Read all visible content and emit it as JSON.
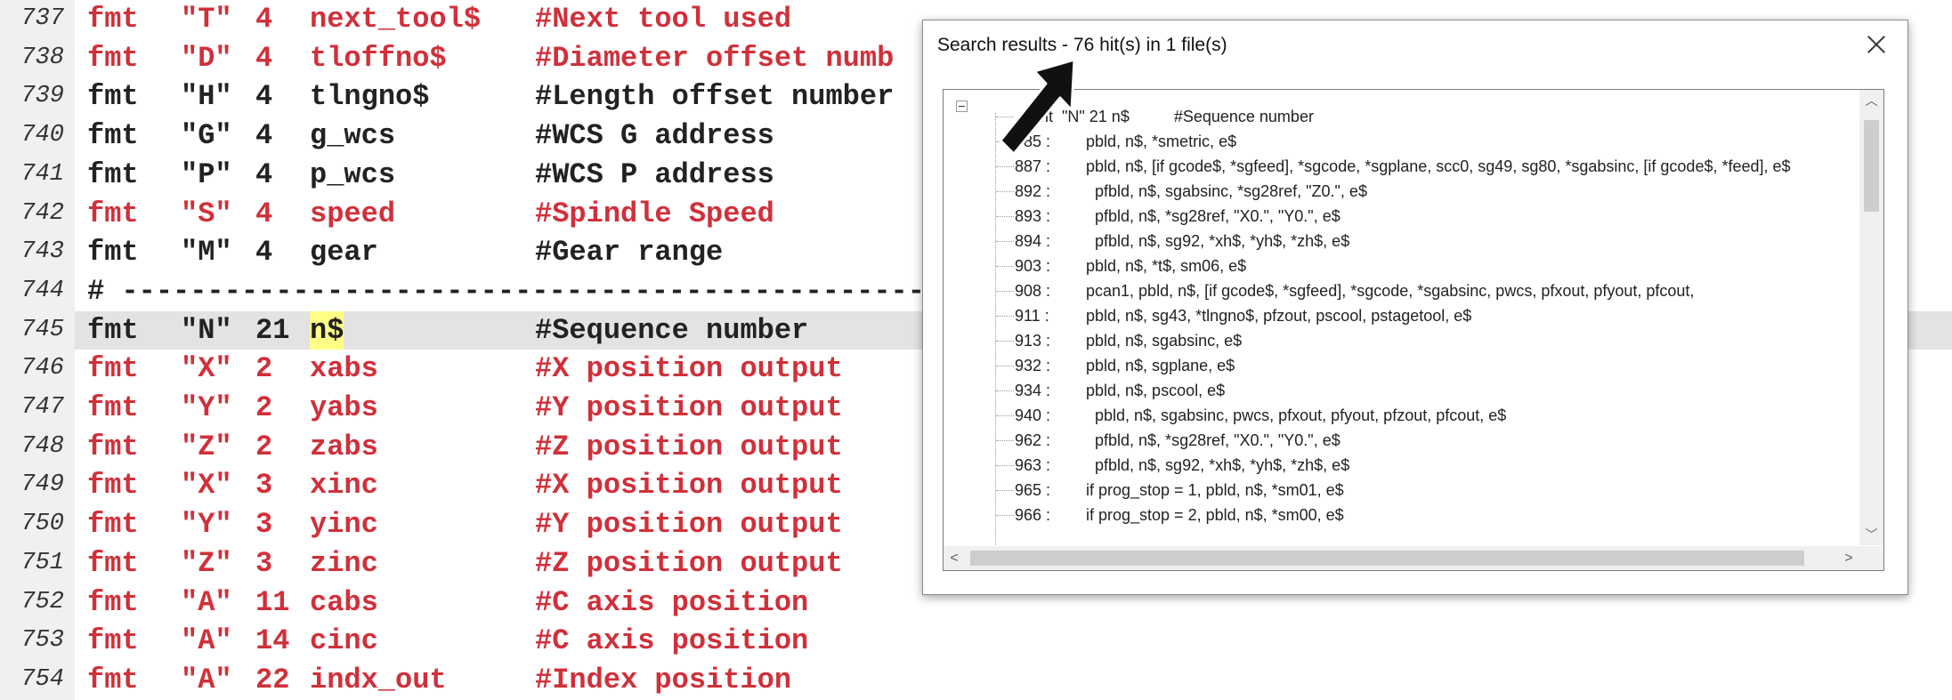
{
  "editor": {
    "lines": [
      {
        "num": "737",
        "fmt": "fmt",
        "str": "\"T\"",
        "n": "4",
        "name": "next_tool$",
        "cmt": "#Next tool used",
        "color": "red"
      },
      {
        "num": "738",
        "fmt": "fmt",
        "str": "\"D\"",
        "n": "4",
        "name": "tloffno$",
        "cmt": "#Diameter offset numb",
        "color": "red"
      },
      {
        "num": "739",
        "fmt": "fmt",
        "str": "\"H\"",
        "n": "4",
        "name": "tlngno$",
        "cmt": "#Length offset number",
        "color": "black"
      },
      {
        "num": "740",
        "fmt": "fmt",
        "str": "\"G\"",
        "n": "4",
        "name": "g_wcs",
        "cmt": "#WCS G address",
        "color": "black"
      },
      {
        "num": "741",
        "fmt": "fmt",
        "str": "\"P\"",
        "n": "4",
        "name": "p_wcs",
        "cmt": "#WCS P address",
        "color": "black"
      },
      {
        "num": "742",
        "fmt": "fmt",
        "str": "\"S\"",
        "n": "4",
        "name": "speed",
        "cmt": "#Spindle Speed",
        "color": "red"
      },
      {
        "num": "743",
        "fmt": "fmt",
        "str": "\"M\"",
        "n": "4",
        "name": "gear",
        "cmt": "#Gear range",
        "color": "black"
      },
      {
        "num": "744",
        "comment_line": "# -------------------------------------------------------------------",
        "color": "black"
      },
      {
        "num": "745",
        "fmt": "fmt",
        "str": "\"N\"",
        "n": "21",
        "name": "n$",
        "cmt": "#Sequence number",
        "color": "black",
        "current": true
      },
      {
        "num": "746",
        "fmt": "fmt",
        "str": "\"X\"",
        "n": "2",
        "name": "xabs",
        "cmt": "#X position output",
        "color": "red"
      },
      {
        "num": "747",
        "fmt": "fmt",
        "str": "\"Y\"",
        "n": "2",
        "name": "yabs",
        "cmt": "#Y position output",
        "color": "red"
      },
      {
        "num": "748",
        "fmt": "fmt",
        "str": "\"Z\"",
        "n": "2",
        "name": "zabs",
        "cmt": "#Z position output",
        "color": "red"
      },
      {
        "num": "749",
        "fmt": "fmt",
        "str": "\"X\"",
        "n": "3",
        "name": "xinc",
        "cmt": "#X position output",
        "color": "red"
      },
      {
        "num": "750",
        "fmt": "fmt",
        "str": "\"Y\"",
        "n": "3",
        "name": "yinc",
        "cmt": "#Y position output",
        "color": "red"
      },
      {
        "num": "751",
        "fmt": "fmt",
        "str": "\"Z\"",
        "n": "3",
        "name": "zinc",
        "cmt": "#Z position output",
        "color": "red"
      },
      {
        "num": "752",
        "fmt": "fmt",
        "str": "\"A\"",
        "n": "11",
        "name": "cabs",
        "cmt": "#C axis position",
        "color": "red"
      },
      {
        "num": "753",
        "fmt": "fmt",
        "str": "\"A\"",
        "n": "14",
        "name": "cinc",
        "cmt": "#C axis position",
        "color": "red"
      },
      {
        "num": "754",
        "fmt": "fmt",
        "str": "\"A\"",
        "n": "22",
        "name": "indx_out",
        "cmt": "#Index position",
        "color": "red"
      }
    ]
  },
  "dialog": {
    "title": "Search results - 76 hit(s) in 1 file(s)",
    "results": [
      {
        "num": "",
        "text": ": fmt  \"N\" 21 n$          #Sequence number"
      },
      {
        "num": "885 :",
        "text": "pbld, n$, *smetric, e$"
      },
      {
        "num": "887 :",
        "text": "pbld, n$, [if gcode$, *sgfeed], *sgcode, *sgplane, scc0, sg49, sg80, *sgabsinc, [if gcode$, *feed], e$"
      },
      {
        "num": "892 :",
        "text": "  pfbld, n$, sgabsinc, *sg28ref, \"Z0.\", e$"
      },
      {
        "num": "893 :",
        "text": "  pfbld, n$, *sg28ref, \"X0.\", \"Y0.\", e$"
      },
      {
        "num": "894 :",
        "text": "  pfbld, n$, sg92, *xh$, *yh$, *zh$, e$"
      },
      {
        "num": "903 :",
        "text": "pbld, n$, *t$, sm06, e$"
      },
      {
        "num": "908 :",
        "text": "pcan1, pbld, n$, [if gcode$, *sgfeed], *sgcode, *sgabsinc, pwcs, pfxout, pfyout, pfcout,"
      },
      {
        "num": "911 :",
        "text": "pbld, n$, sg43, *tlngno$, pfzout, pscool, pstagetool, e$"
      },
      {
        "num": "913 :",
        "text": "pbld, n$, sgabsinc, e$"
      },
      {
        "num": "932 :",
        "text": "pbld, n$, sgplane, e$"
      },
      {
        "num": "934 :",
        "text": "pbld, n$, pscool, e$"
      },
      {
        "num": "940 :",
        "text": "  pbld, n$, sgabsinc, pwcs, pfxout, pfyout, pfzout, pfcout, e$"
      },
      {
        "num": "962 :",
        "text": "  pfbld, n$, *sg28ref, \"X0.\", \"Y0.\", e$"
      },
      {
        "num": "963 :",
        "text": "  pfbld, n$, sg92, *xh$, *yh$, *zh$, e$"
      },
      {
        "num": "965 :",
        "text": "if prog_stop = 1, pbld, n$, *sm01, e$"
      },
      {
        "num": "966 :",
        "text": "if prog_stop = 2, pbld, n$, *sm00, e$"
      }
    ],
    "scroll_up": "︿",
    "scroll_down": "﹀",
    "scroll_left": "<",
    "scroll_right": ">"
  },
  "colors": {
    "red": "#d0303a",
    "black": "#222222",
    "highlight": "#ffff88",
    "current_line": "#e3e3e3"
  },
  "icons": [
    "close-icon",
    "collapse-icon",
    "arrow-pointer-icon"
  ]
}
